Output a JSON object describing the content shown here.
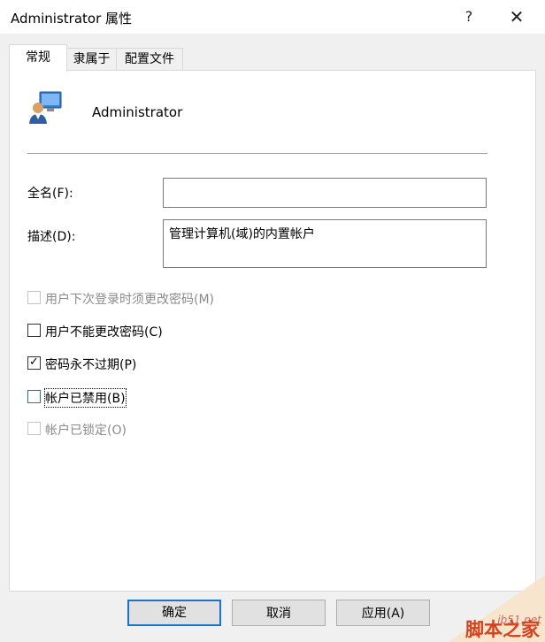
{
  "window": {
    "title": "Administrator 属性",
    "help_label": "?",
    "close_label": "✕"
  },
  "tabs": [
    {
      "label": "常规",
      "active": true
    },
    {
      "label": "隶属于",
      "active": false
    },
    {
      "label": "配置文件",
      "active": false
    }
  ],
  "general": {
    "user_name": "Administrator",
    "user_icon": "user-computer-icon",
    "fullname": {
      "label": "全名(F):",
      "value": ""
    },
    "description": {
      "label": "描述(D):",
      "value": "管理计算机(域)的内置帐户"
    },
    "checkboxes": [
      {
        "label": "用户下次登录时须更改密码(M)",
        "checked": false,
        "disabled": true
      },
      {
        "label": "用户不能更改密码(C)",
        "checked": false,
        "disabled": false
      },
      {
        "label": "密码永不过期(P)",
        "checked": true,
        "disabled": false
      },
      {
        "label": "帐户已禁用(B)",
        "checked": false,
        "disabled": false,
        "focused": true
      },
      {
        "label": "帐户已锁定(O)",
        "checked": false,
        "disabled": true
      }
    ]
  },
  "buttons": {
    "ok": "确定",
    "cancel": "取消",
    "apply": "应用(A)"
  },
  "watermark": {
    "url": "jb51.net",
    "text": "脚本之家"
  },
  "colors": {
    "accent": "#1a73c8",
    "disabled_text": "#8a8a8a",
    "watermark": "#d3411d"
  }
}
